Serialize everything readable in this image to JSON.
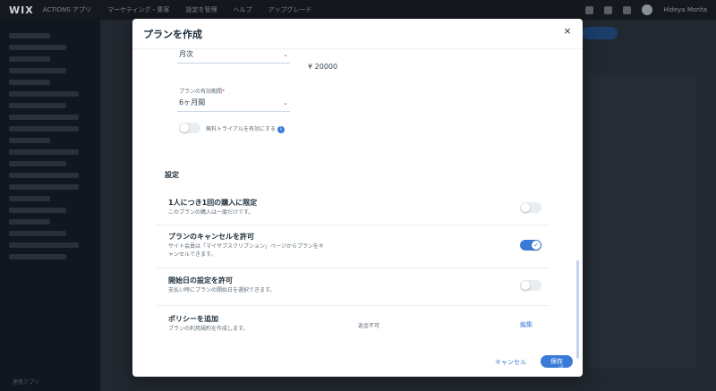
{
  "app": {
    "logo": "WIX",
    "nav": [
      "ACTIONS アプリ",
      "マーケティング・集客",
      "設定を管理",
      "ヘルプ",
      "アップグレード"
    ],
    "user": "Hideya Morita",
    "sidebar_footer": "連携アプリ"
  },
  "modal": {
    "title": "プランを作成",
    "close": "×",
    "billing_cycle": "月次",
    "price": "¥ 20000",
    "duration_label": "プランの有効期間",
    "duration_required": "*",
    "duration_value": "6ヶ月間",
    "free_trial_label": "無料トライアルを有効にする",
    "info": "i",
    "settings_title": "設定",
    "rows": [
      {
        "title": "1人につき1回の購入に限定",
        "desc": "このプランの購入は一度だけです。",
        "on": false
      },
      {
        "title": "プランのキャンセルを許可",
        "desc1": "サイト会員は「マイサブスクリプション」ページからプランをキ",
        "desc2": "ャンセルできます。",
        "on": true
      },
      {
        "title": "開始日の設定を許可",
        "desc": "支払い時にプランの開始日を選択できます。",
        "on": false
      },
      {
        "title": "ポリシーを追加",
        "desc": "プランの利用規約を作成します。",
        "status": "返金不可",
        "action": "編集"
      }
    ],
    "check": "✓",
    "cancel": "キャンセル",
    "save": "保存"
  },
  "icons": {
    "chevron": "⌄"
  },
  "colors": {
    "accent": "#3b7bd8",
    "title": "#20303c"
  }
}
